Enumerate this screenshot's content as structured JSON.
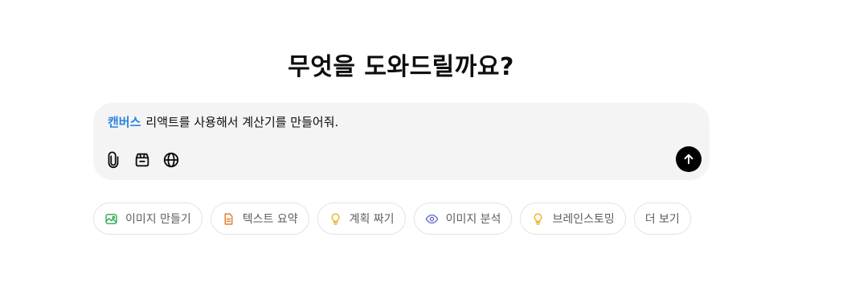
{
  "heading": "무엇을 도와드릴까요?",
  "composer": {
    "tag": "캔버스",
    "text": "리액트를 사용해서 계산기를 만들어줘.",
    "tools": [
      {
        "icon": "paperclip-icon"
      },
      {
        "icon": "toolbox-icon"
      },
      {
        "icon": "globe-icon"
      }
    ],
    "send_icon": "arrow-up-icon"
  },
  "chips": [
    {
      "label": "이미지 만들기",
      "icon": "image-icon",
      "color": "#2fa84f"
    },
    {
      "label": "텍스트 요약",
      "icon": "document-icon",
      "color": "#e47a2e"
    },
    {
      "label": "계획 짜기",
      "icon": "lightbulb-icon",
      "color": "#e8b62b"
    },
    {
      "label": "이미지 분석",
      "icon": "eye-icon",
      "color": "#6c71c4"
    },
    {
      "label": "브레인스토밍",
      "icon": "lightbulb-icon",
      "color": "#e8b62b"
    },
    {
      "label": "더 보기",
      "icon": "",
      "color": ""
    }
  ],
  "colors": {
    "accent": "#2b84e0",
    "composer_bg": "#f4f4f4",
    "send_bg": "#000000"
  }
}
